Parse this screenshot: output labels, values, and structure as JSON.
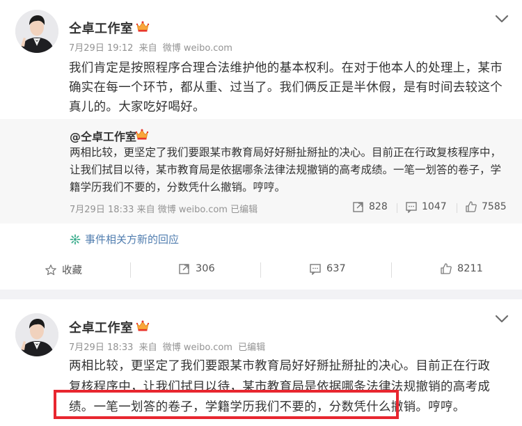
{
  "posts": [
    {
      "author": "仝卓工作室",
      "time": "7月29日 19:12",
      "source_prefix": "来自",
      "source": "微博 weibo.com",
      "text": "我们肯定是按照程序合理合法维护他的基本权利。在对于他本人的处理上，某市确实在每一个环节，都从重、过当了。我们俩反正是半休假，是有时间去较这个真儿的。大家吃好喝好。",
      "quoted": {
        "author": "@仝卓工作室",
        "text": "两相比较，更坚定了我们要跟某市教育局好好掰扯掰扯的决心。目前正在行政复核程序中，让我们拭目以待，某市教育局是依据哪条法律法规撤销的高考成绩。一笔一划答的卷子，学籍学历我们不要的，分数凭什么撤销。哼哼。",
        "time": "7月29日 18:33",
        "source_prefix": "来自",
        "source": "微博 weibo.com",
        "edited": "已编辑",
        "reposts": "828",
        "comments": "1047",
        "likes": "7585"
      },
      "event_link": "事件相关方新的回应",
      "actions": {
        "favorite": "收藏",
        "reposts": "306",
        "comments": "637",
        "likes": "8211"
      }
    },
    {
      "author": "仝卓工作室",
      "time": "7月29日 18:33",
      "source_prefix": "来自",
      "source": "微博 weibo.com",
      "edited": "已编辑",
      "text": "两相比较，更坚定了我们要跟某市教育局好好掰扯掰扯的决心。目前正在行政复核程序中，让我们拭目以待，某市教育局是依据哪条法律法规撤销的高考成绩。一笔一划答的卷子，学籍学历我们不要的，分数凭什么撤销。哼哼。"
    }
  ],
  "icons": {
    "vip": "vip-crown-icon",
    "chevron": "chevron-down-icon",
    "repost": "repost-icon",
    "comment": "comment-icon",
    "like": "thumbs-up-icon",
    "favorite": "star-icon",
    "event": "event-icon"
  },
  "colors": {
    "link": "#507daf",
    "meta": "#939393",
    "highlight_border": "#e8262f",
    "quote_bg": "#f7f7f7"
  }
}
